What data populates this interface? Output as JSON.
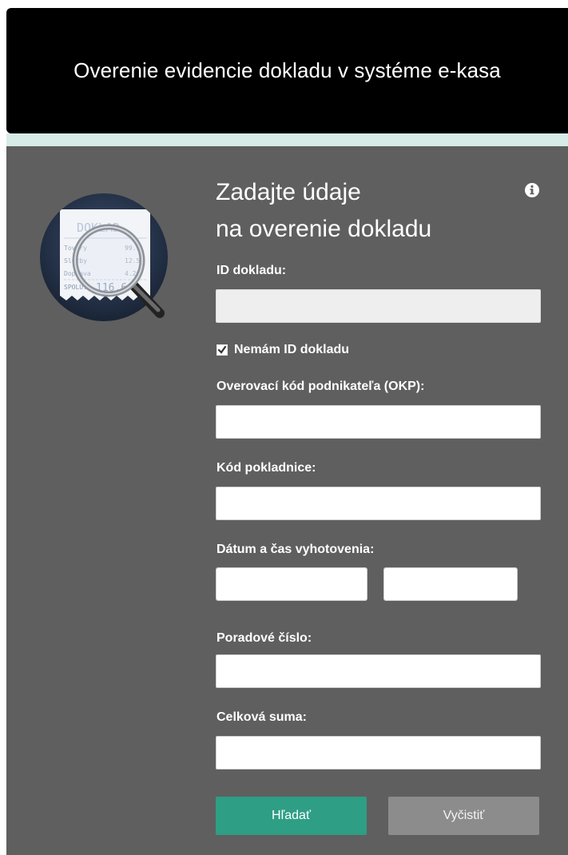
{
  "header": {
    "title": "Overenie evidencie dokladu v systéme e-kasa"
  },
  "logo": {
    "receipt_title": "DOKLAD",
    "lines": [
      {
        "label": "Tovary",
        "value": "99.9"
      },
      {
        "label": "Služby",
        "value": "12.50"
      },
      {
        "label": "Doprava",
        "value": "4.20"
      },
      {
        "label": "SPOLU:",
        "value": "116.6"
      }
    ]
  },
  "form": {
    "heading_line1": "Zadajte údaje",
    "heading_line2": "na overenie dokladu",
    "id_label": "ID dokladu:",
    "id_value": "",
    "no_id_checkbox": {
      "label": "Nemám ID dokladu",
      "checked": true
    },
    "okp_label": "Overovací kód podnikateľa (OKP):",
    "okp_value": "",
    "cash_register_label": "Kód pokladnice:",
    "cash_register_value": "",
    "datetime_label": "Dátum a čas vyhotovenia:",
    "date_value": "",
    "time_value": "",
    "serial_label": "Poradové číslo:",
    "serial_value": "",
    "total_label": "Celková suma:",
    "total_value": ""
  },
  "buttons": {
    "search": "Hľadať",
    "clear": "Vyčistiť"
  },
  "icons": {
    "info": "info-icon",
    "calendar": "calendar-icon",
    "clock": "clock-icon",
    "checkbox": "checkbox-checked-icon",
    "logo": "receipt-magnifier-icon"
  },
  "colors": {
    "header_bg": "#000000",
    "panel_bg": "#5f5f5f",
    "strip": "#d7ece7",
    "primary_button": "#2e9e85",
    "secondary_button": "#8c8c8c"
  }
}
